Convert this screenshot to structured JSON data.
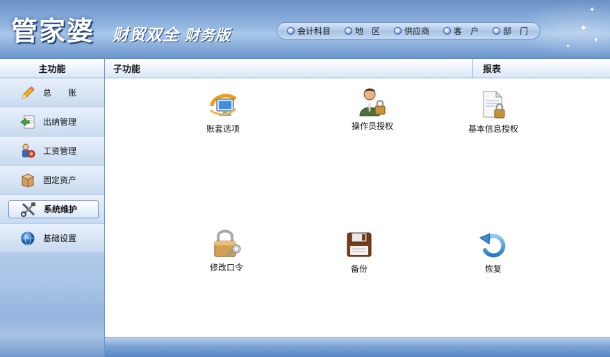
{
  "header": {
    "brand_main": "管家婆",
    "brand_sub": "财贸双全",
    "brand_edition": "财务版",
    "quick_nav": [
      {
        "label": "会计科目"
      },
      {
        "label": "地　区"
      },
      {
        "label": "供应商"
      },
      {
        "label": "客　户"
      },
      {
        "label": "部　门"
      }
    ]
  },
  "sidebar": {
    "title": "主功能",
    "items": [
      {
        "label": "总　　账",
        "icon": "pencil-icon"
      },
      {
        "label": "出纳管理",
        "icon": "cashier-icon"
      },
      {
        "label": "工资管理",
        "icon": "payroll-icon"
      },
      {
        "label": "固定资产",
        "icon": "box-icon"
      },
      {
        "label": "系统维护",
        "icon": "tools-icon",
        "active": true
      },
      {
        "label": "基础设置",
        "icon": "globe-icon"
      }
    ]
  },
  "main": {
    "sub_title": "子功能",
    "report_title": "报表",
    "functions": [
      {
        "label": "账套选项",
        "icon": "monitor-icon"
      },
      {
        "label": "操作员授权",
        "icon": "operator-lock-icon"
      },
      {
        "label": "基本信息授权",
        "icon": "document-lock-icon"
      },
      {
        "label": "修改口令",
        "icon": "padlock-key-icon"
      },
      {
        "label": "备份",
        "icon": "floppy-disk-icon"
      },
      {
        "label": "恢复",
        "icon": "restore-arrow-icon"
      }
    ]
  },
  "colors": {
    "header_blue": "#6f9ad0",
    "panel_border": "#8fb0dc",
    "footer_blue": "#7ca3d6"
  }
}
